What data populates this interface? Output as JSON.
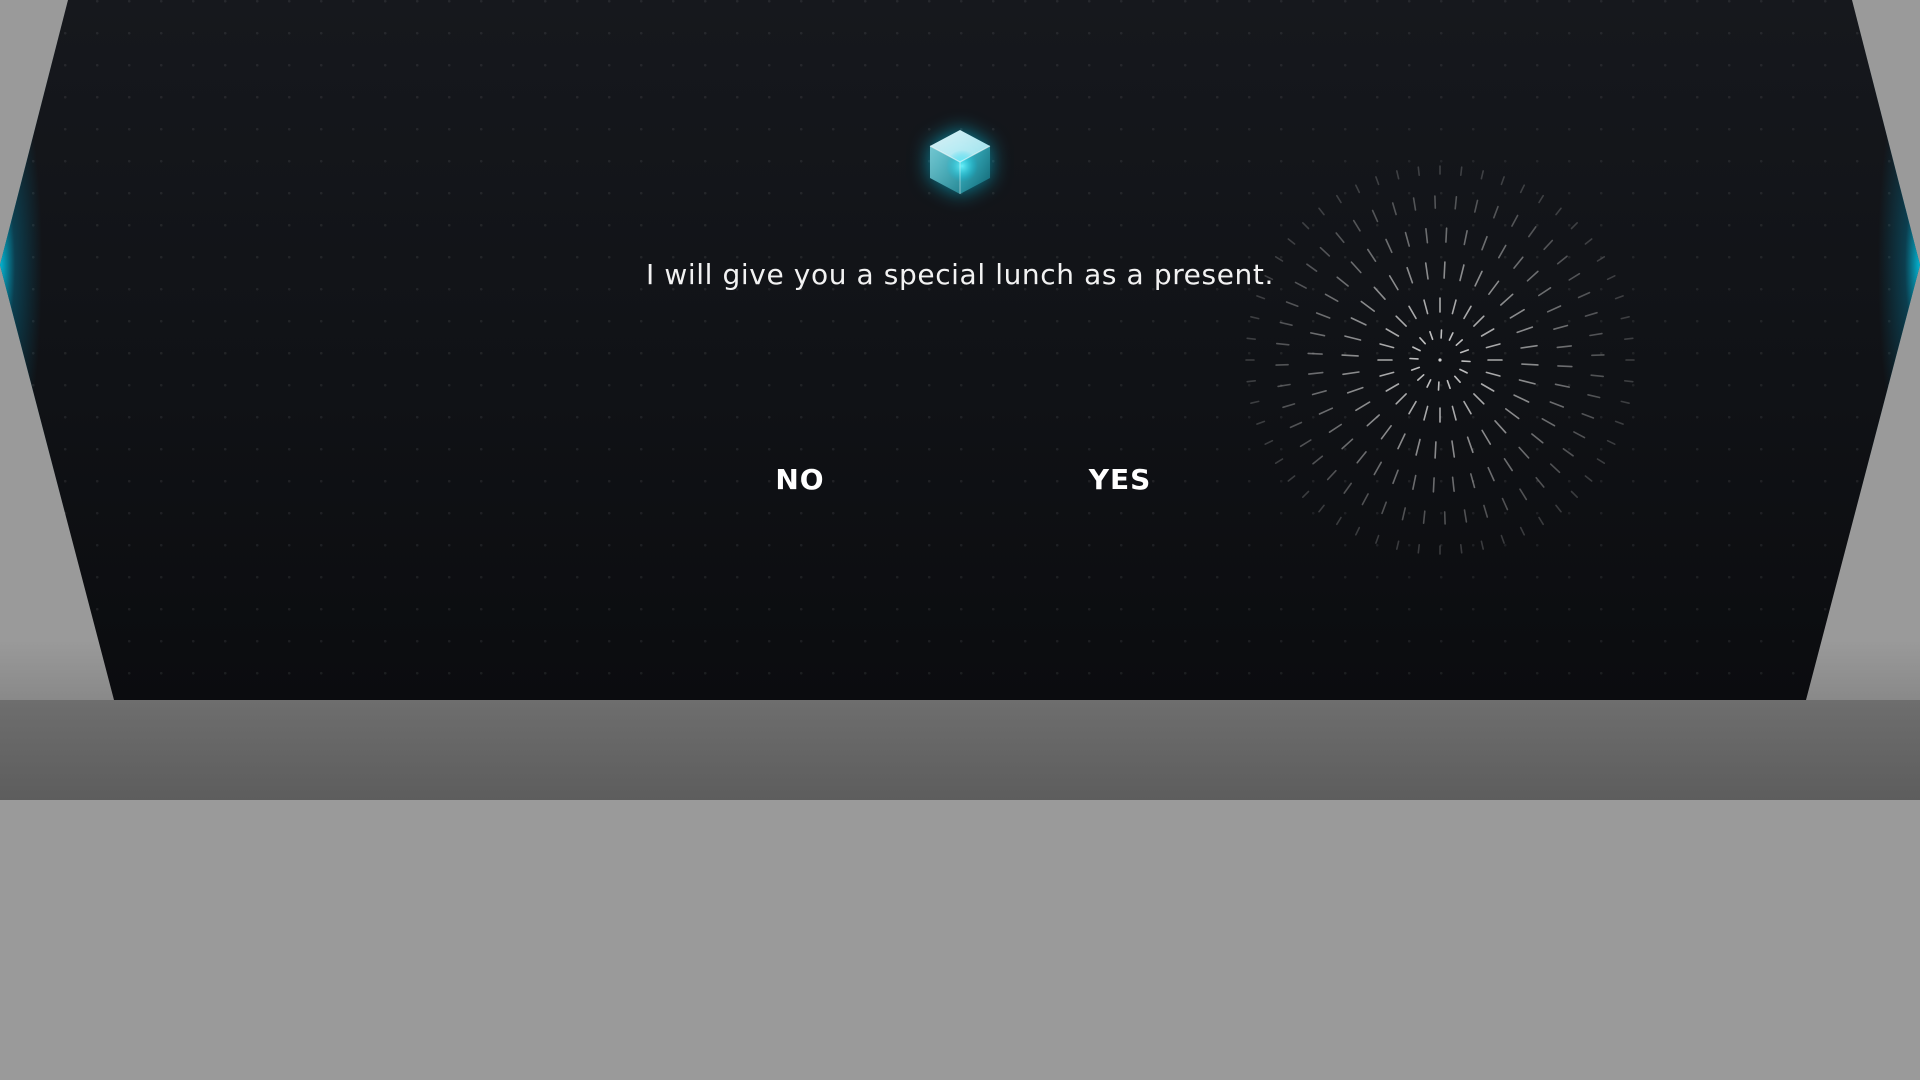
{
  "dialog": {
    "message": "I will give you a special lunch as a present.",
    "icon": "crystal-cube-icon"
  },
  "choices": {
    "no_label": "NO",
    "yes_label": "YES"
  },
  "decorations": {
    "burst": "starburst-icon"
  },
  "colors": {
    "panel_background": "#111318",
    "accent_glow": "#00dcff",
    "backdrop": "#9a9a9a",
    "footer_bar": "#666666",
    "text": "#f2f2f2"
  }
}
